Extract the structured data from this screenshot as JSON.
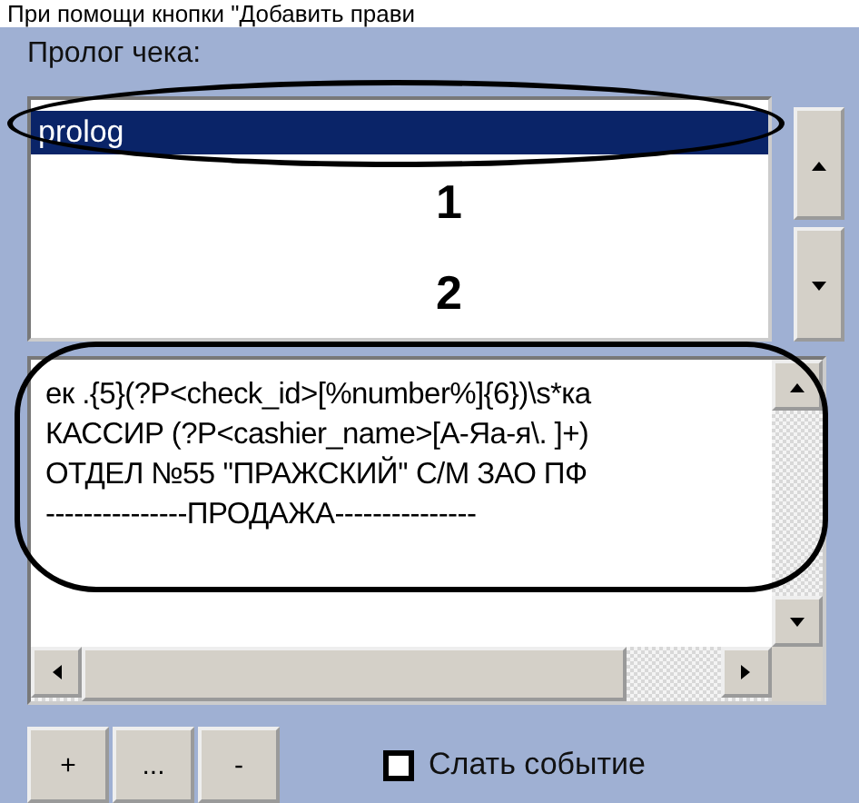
{
  "caption": "При помощи кнопки \"Добавить прави",
  "prolog_label": "Пролог чека:",
  "prolog_list": {
    "items": [
      {
        "label": "prolog",
        "selected": true
      }
    ]
  },
  "rule_text": {
    "lines": [
      "ек .{5}(?P<check_id>[%number%]{6})\\s*ка",
      "КАССИР (?P<cashier_name>[А-Яа-я\\. ]+)",
      "ОТДЕЛ №55 ''ПРАЖСКИЙ'' С/М ЗАО ПФ",
      "---------------ПРОДАЖА---------------"
    ]
  },
  "buttons": [
    "+",
    "...",
    "-"
  ],
  "send_event": {
    "label": "Слать событие",
    "checked": false
  },
  "annotations": [
    {
      "label": "1"
    },
    {
      "label": "2"
    }
  ]
}
